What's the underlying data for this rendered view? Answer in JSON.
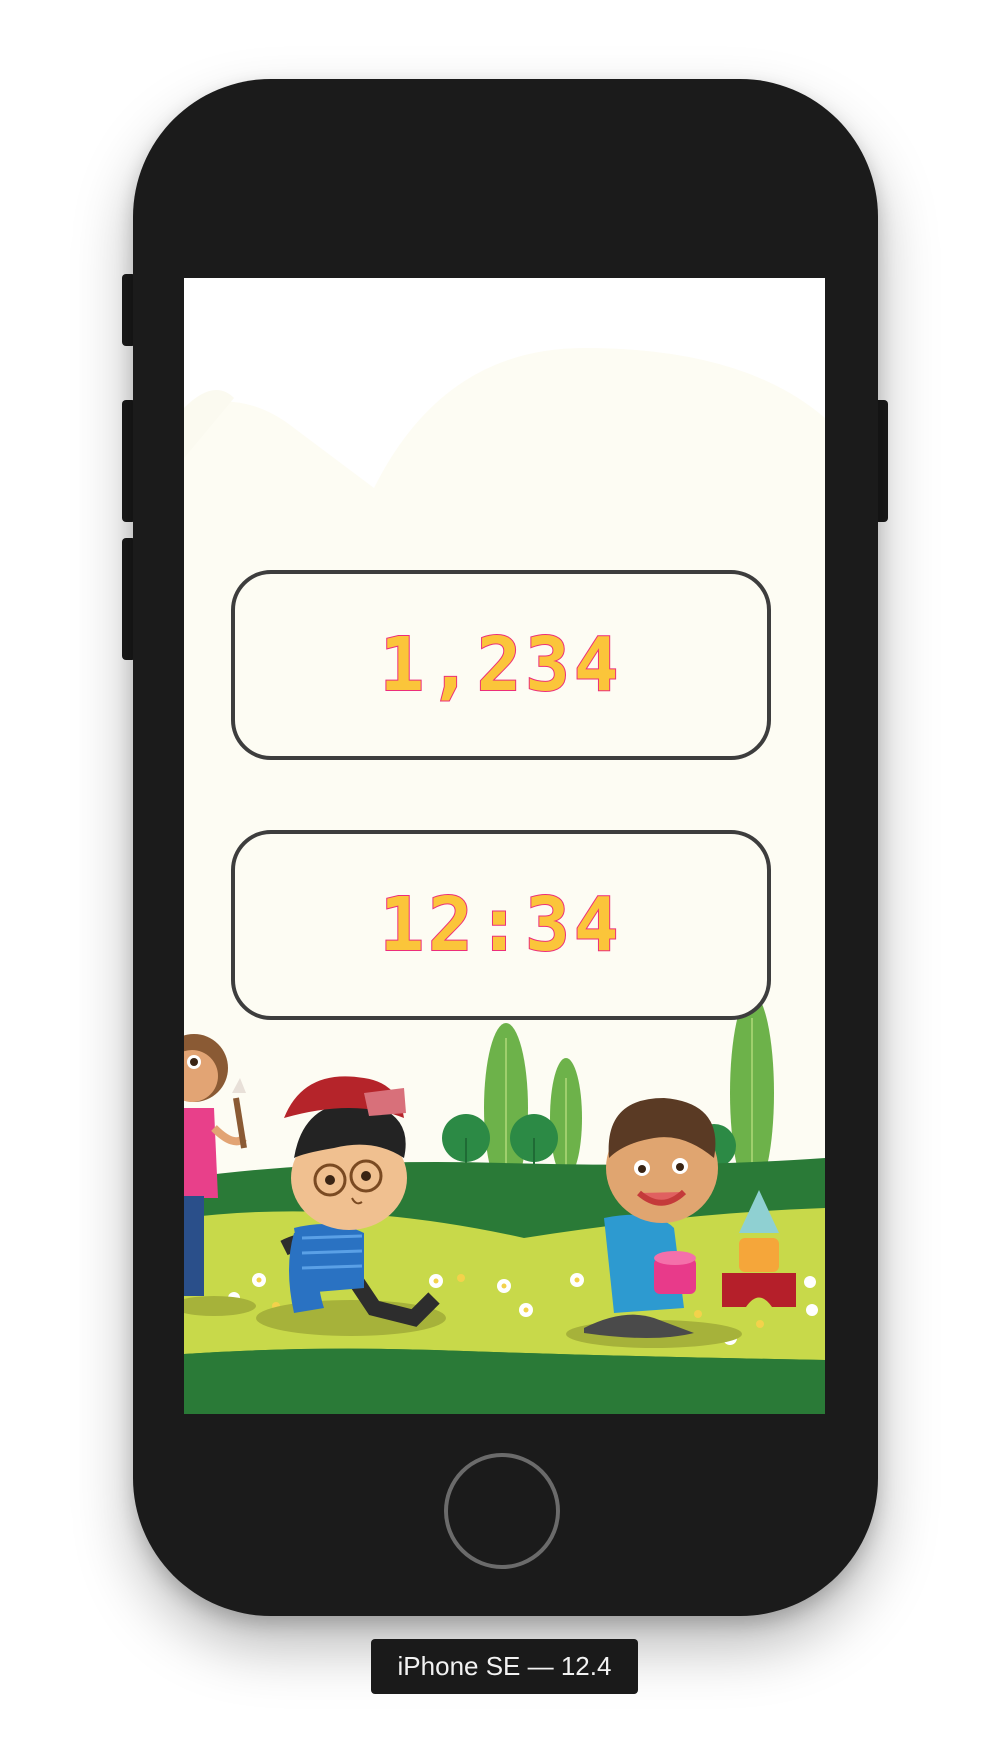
{
  "device": {
    "label": "iPhone SE — 12.4"
  },
  "game": {
    "score": "1,234",
    "timer": "12:34"
  },
  "colors": {
    "digit_fill": "#fbc53a",
    "digit_outline": "#ec2f7a",
    "box_border": "#3d3d3d",
    "box_fill": "#fdfcf3",
    "grass_dark": "#2a7a37",
    "grass_light": "#c8d94a",
    "phone_body": "#1b1b1b"
  },
  "icons": {
    "home": "home-button-icon"
  }
}
